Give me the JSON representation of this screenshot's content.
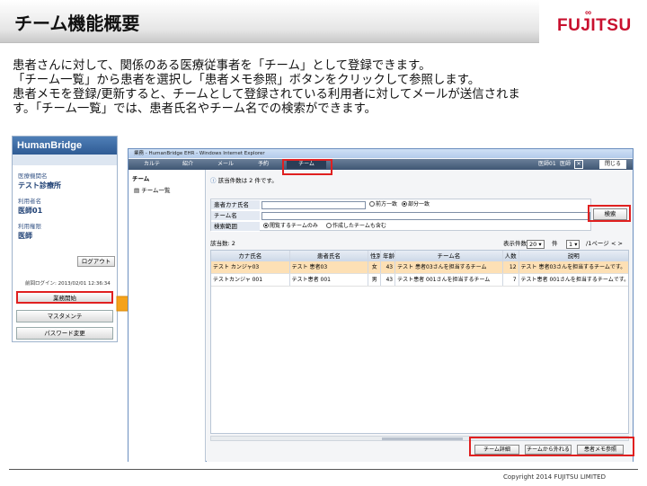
{
  "slide": {
    "title": "チーム機能概要",
    "logo": "FUJITSU",
    "description": [
      "患者さんに対して、関係のある医療従事者を「チーム」として登録できます。",
      "「チーム一覧」から患者を選択し「患者メモ参照」ボタンをクリックして参照します。",
      "患者メモを登録/更新すると、チームとして登録されている利用者に対してメールが送信されま",
      "す。「チーム一覧」では、患者氏名やチーム名での検索ができます。"
    ],
    "copyright": "Copyright 2014 FUJITSU LIMITED"
  },
  "left_panel": {
    "brand": "HumanBridge",
    "institution_label": "医療機関名",
    "institution_value": "テスト診療所",
    "user_label": "利用者名",
    "user_value": "医師01",
    "role_label": "利用権限",
    "role_value": "医師",
    "logout_button": "ログアウト",
    "last_login": "前回ログイン: 2013/02/01 12:36:34",
    "menu": [
      "業務開始",
      "マスタメンテ",
      "パスワード変更"
    ]
  },
  "browser": {
    "window_title": "業務 - HumanBridge EHR - Windows Internet Explorer",
    "tabs": [
      "カルテ",
      "紹介",
      "メール",
      "予約",
      "チーム"
    ],
    "active_tab": "チーム",
    "user_info": [
      "医師01",
      "医師"
    ],
    "close_label": "閉じる",
    "tree_header": "チーム",
    "tree_items": [
      "チーム一覧"
    ],
    "result_count_top": "該当件数は 2 件です。",
    "search": {
      "kana_label": "患者カナ氏名",
      "team_label": "チーム名",
      "scope_label": "検索範囲",
      "match_options": [
        "前方一致",
        "部分一致"
      ],
      "match_selected": "部分一致",
      "scope_options": [
        "閲覧するチームのみ",
        "作成したチームも含む"
      ],
      "scope_selected": "閲覧するチームのみ",
      "search_button": "検索"
    },
    "result_bar": {
      "count_label": "該当数: 2",
      "per_page_label": "表示件数",
      "per_page_value": "20",
      "per_page_unit": "件",
      "page_value": "1",
      "page_total": "/1ページ",
      "pager_arrows": "<  >"
    },
    "table": {
      "columns": [
        "カナ氏名",
        "患者氏名",
        "性別",
        "年齢",
        "チーム名",
        "人数",
        "説明"
      ],
      "rows": [
        [
          "テスト カンジャ03",
          "テスト 患者03",
          "女",
          "43",
          "テスト 患者03さんを担当するチーム",
          "12",
          "テスト 患者03さんを担当するチームです。"
        ],
        [
          "テストカンジャ 001",
          "テスト患者 001",
          "男",
          "43",
          "テスト患者 001さんを担当するチーム",
          "7",
          "テスト患者 001さんを担当するチームです。"
        ]
      ]
    },
    "action_buttons": [
      "チーム詳細",
      "チームから外れる",
      "患者メモ参照"
    ]
  },
  "colors": {
    "highlight_red": "#e02020",
    "selected_row": "#fde0b5",
    "brand_blue": "#2f5b94",
    "logo_red": "#c8102e",
    "arrow_orange": "#f5a21b"
  }
}
